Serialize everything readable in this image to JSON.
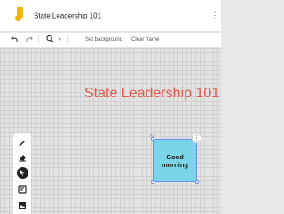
{
  "app": {
    "title": "State Leadership 101",
    "more_glyph": "⋮"
  },
  "toolbar": {
    "undo_icon": "undo-icon",
    "redo_icon": "redo-icon",
    "zoom_icon": "zoom-icon",
    "zoom_dropdown_glyph": "▾",
    "set_background_label": "Set background",
    "clear_frame_label": "Clear frame"
  },
  "canvas": {
    "heading": "State Leadership 101",
    "heading_color": "#e45a4e",
    "sticky_note": {
      "text": "Good morning",
      "color": "#7ad5e8",
      "selection_color": "#6a8ff0",
      "menu_glyph": "⋮"
    }
  },
  "tools": [
    {
      "name": "pen-icon"
    },
    {
      "name": "eraser-icon"
    },
    {
      "name": "select-icon",
      "active": true
    },
    {
      "name": "sticky-note-icon"
    },
    {
      "name": "image-icon"
    }
  ]
}
